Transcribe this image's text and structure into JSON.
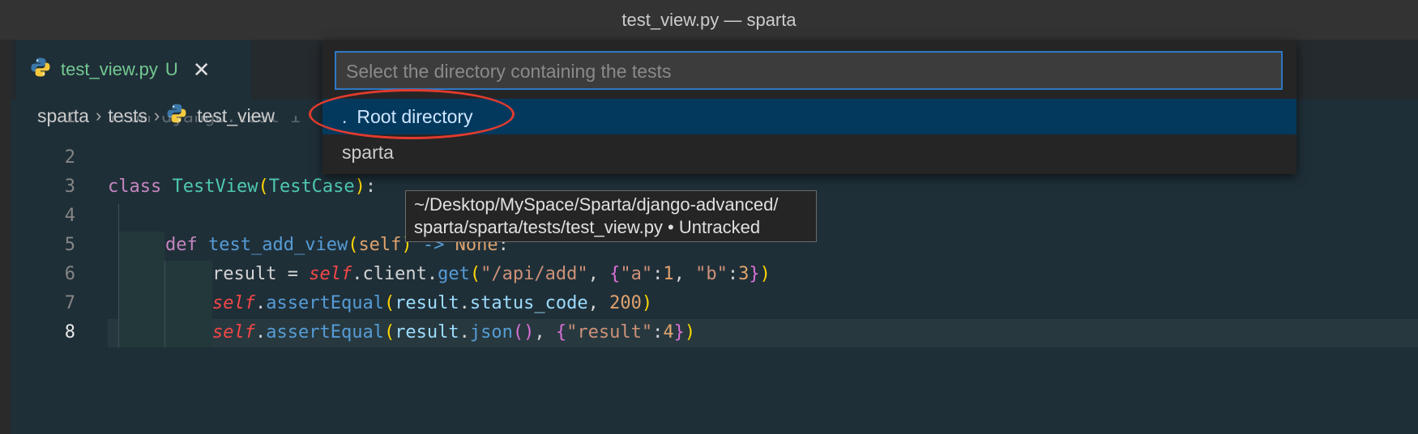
{
  "window": {
    "title": "test_view.py — sparta"
  },
  "tab": {
    "name": "test_view.py",
    "status": "U",
    "close_glyph": "✕",
    "icon": "python-icon"
  },
  "breadcrumb": [
    "sparta",
    "tests",
    "test_view"
  ],
  "editor": {
    "line_numbers": [
      "1",
      "2",
      "3",
      "4",
      "5",
      "6",
      "7",
      "8"
    ],
    "active_line": "8",
    "line1_partial": "from django.test i"
  },
  "quick_pick": {
    "placeholder": "Select the directory containing the tests",
    "value": "",
    "items": [
      {
        "prefix": ".",
        "label": "Root directory",
        "selected": true
      },
      {
        "prefix": "",
        "label": "sparta",
        "selected": false
      }
    ]
  },
  "tooltip": {
    "line1": "~/Desktop/MySpace/Sparta/django-advanced/",
    "line2": "sparta/sparta/tests/test_view.py • Untracked"
  },
  "colors": {
    "annotation": "#e23b2e",
    "selection": "#04395e",
    "focus_border": "#2f78c4",
    "untracked": "#73c991"
  }
}
